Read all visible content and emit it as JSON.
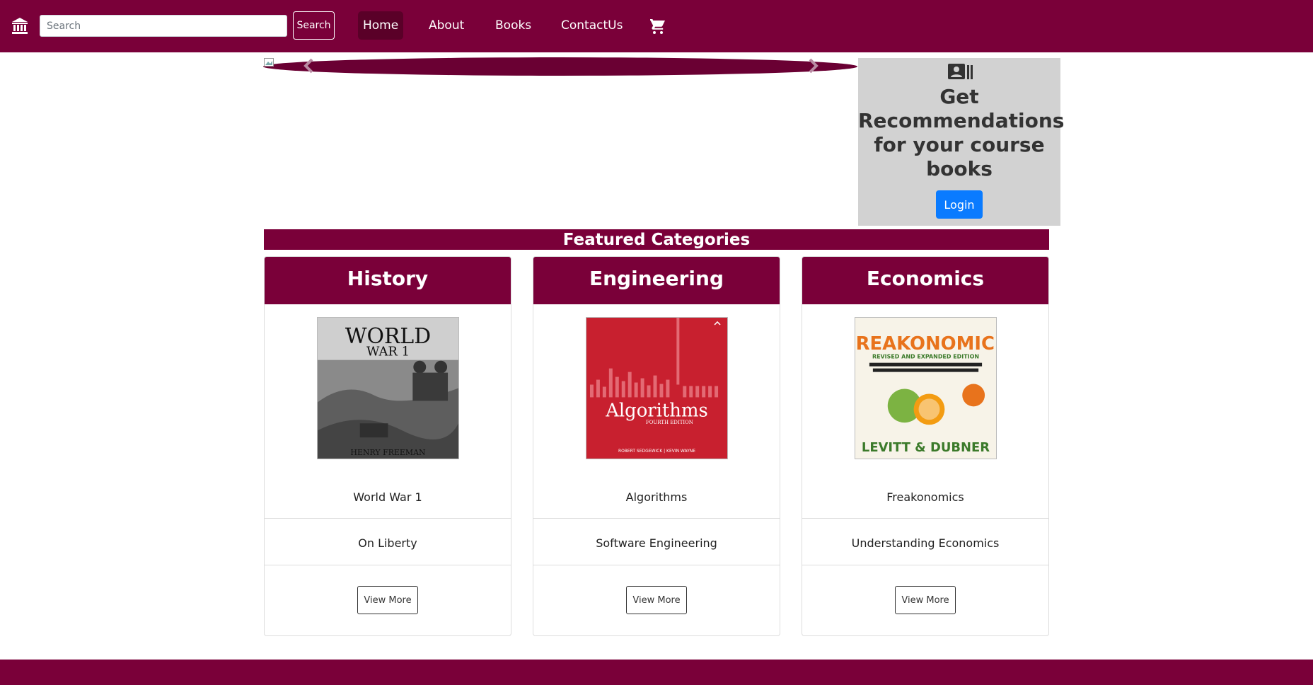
{
  "navbar": {
    "brand_icon": "bank-icon",
    "search_placeholder": "Search",
    "search_button": "Search",
    "links": [
      "Home",
      "About",
      "Books",
      "ContactUs"
    ],
    "active_link": "Home",
    "cart_icon": "cart-icon",
    "bg_color": "#7a0039"
  },
  "carousel": {
    "prev_icon": "chevron-left-icon",
    "next_icon": "chevron-right-icon"
  },
  "recommend": {
    "icon": "contact-card-icon",
    "title": "Get Recommendations for your course books",
    "login_button": "Login"
  },
  "featured": {
    "title": "Featured Categories",
    "categories": [
      {
        "name": "History",
        "book": "World War 1",
        "second": "On Liberty",
        "button": "View More",
        "cover_title": "WORLD",
        "cover_sub": "WAR 1",
        "cover_author": "HENRY FREEMAN"
      },
      {
        "name": "Engineering",
        "book": "Algorithms",
        "second": "Software Engineering",
        "button": "View More",
        "cover_title": "Algorithms",
        "cover_sub": "FOURTH EDITION",
        "cover_author": "ROBERT SEDGEWICK | KEVIN WAYNE"
      },
      {
        "name": "Economics",
        "book": "Freakonomics",
        "second": "Understanding Economics",
        "button": "View More",
        "cover_title": "FREAKONOMICS",
        "cover_sub": "REVISED AND EXPANDED EDITION",
        "cover_author": "LEVITT & DUBNER"
      }
    ]
  }
}
